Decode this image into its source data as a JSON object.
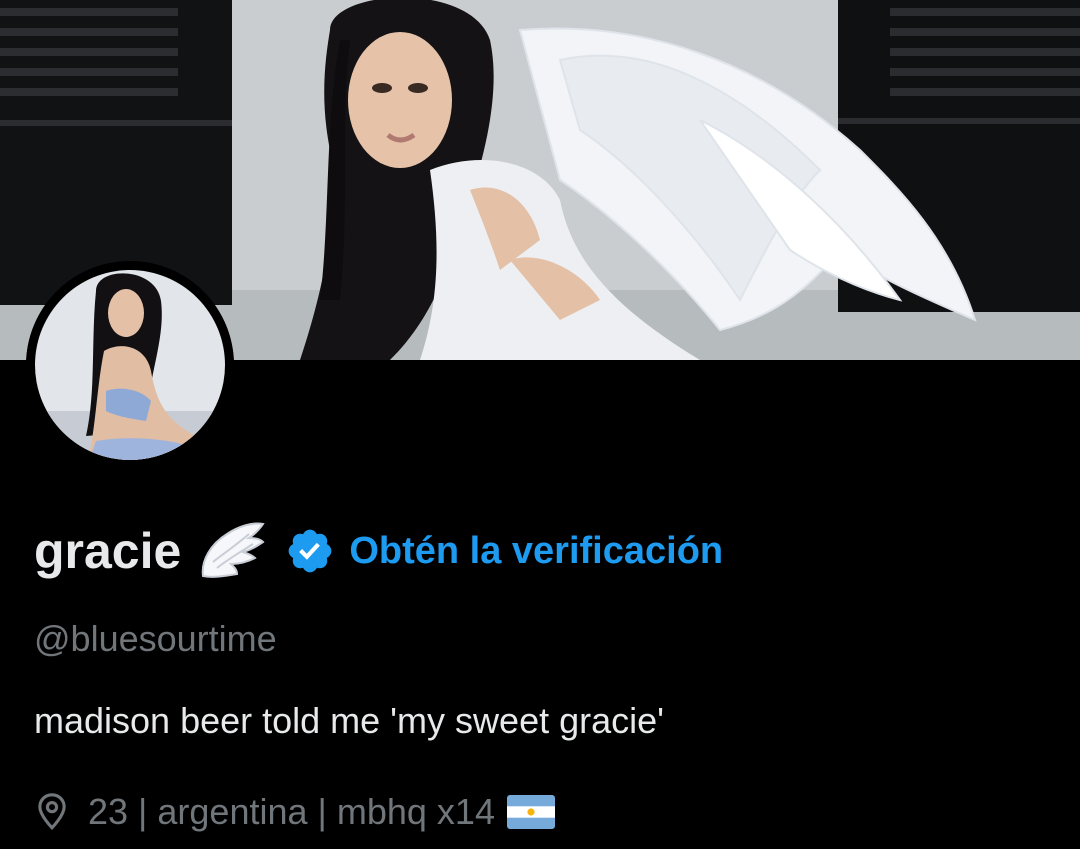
{
  "profile": {
    "display_name": "gracie",
    "name_emoji": "wing-icon",
    "verified_icon": "verified-badge-icon",
    "get_verified_label": "Obtén la verificación",
    "handle": "@bluesourtime",
    "bio": "madison beer told me 'my sweet gracie'",
    "location_icon": "location-pin-icon",
    "location": "23 | argentina | mbhq x14",
    "location_flag": "argentina-flag-icon"
  },
  "colors": {
    "background": "#000000",
    "primary_text": "#e7e9ea",
    "secondary_text": "#71767b",
    "accent": "#1d9bf0"
  }
}
